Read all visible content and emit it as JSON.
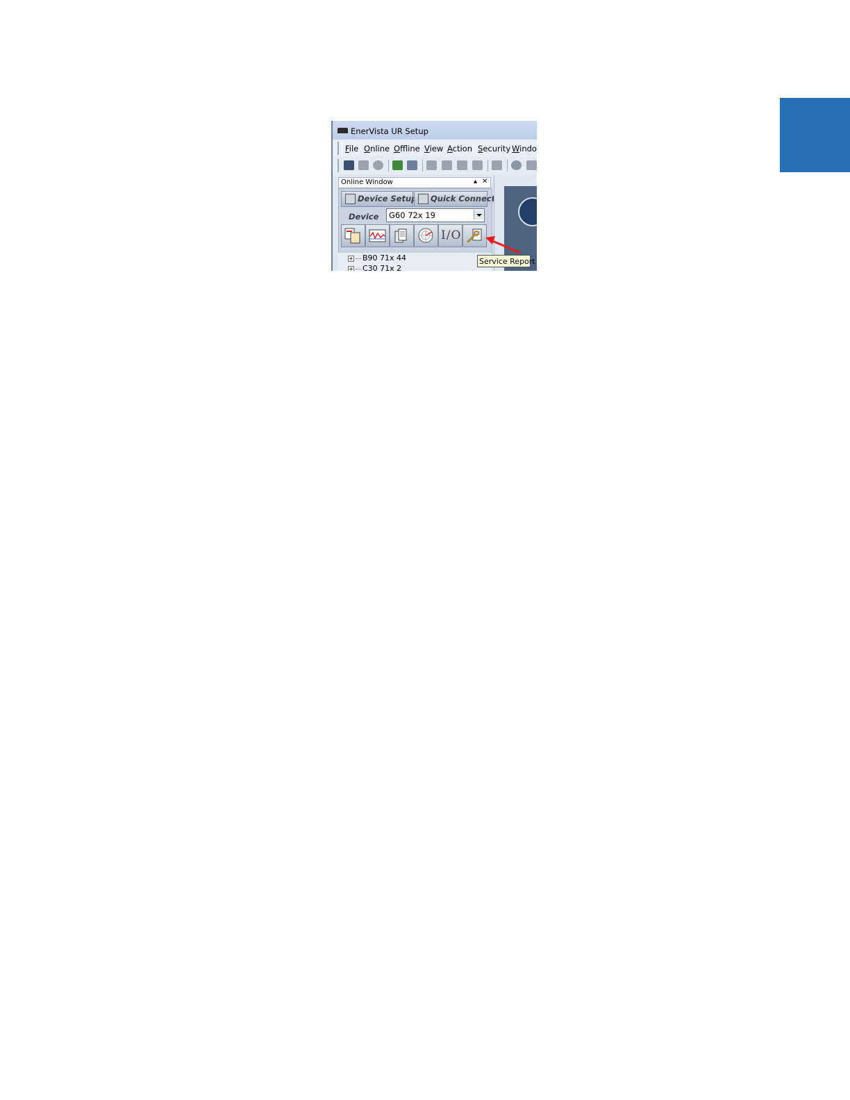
{
  "window": {
    "title": "EnerVista UR Setup"
  },
  "menu": {
    "items": [
      "File",
      "Online",
      "Offline",
      "View",
      "Action",
      "Security",
      "Window"
    ]
  },
  "online_window": {
    "title": "Online Window",
    "pin_glyph": "▴",
    "close_glyph": "✕",
    "device_setup_label": "Device Setup",
    "quick_connect_label": "Quick Connect",
    "device_label": "Device",
    "device_value": "G60 72x 19",
    "io_label": "I/O",
    "tree_items": [
      "B90 71x 44",
      "C30 71x 2"
    ]
  },
  "tooltip": {
    "text": "Service Report"
  },
  "colors": {
    "side_tab": "#2770b8",
    "arrow": "#e81e1e"
  },
  "icons": {
    "tools": [
      "settings-compare-icon",
      "waveform-icon",
      "documents-icon",
      "phasor-diagram-icon",
      "io-icon",
      "service-report-icon"
    ]
  }
}
